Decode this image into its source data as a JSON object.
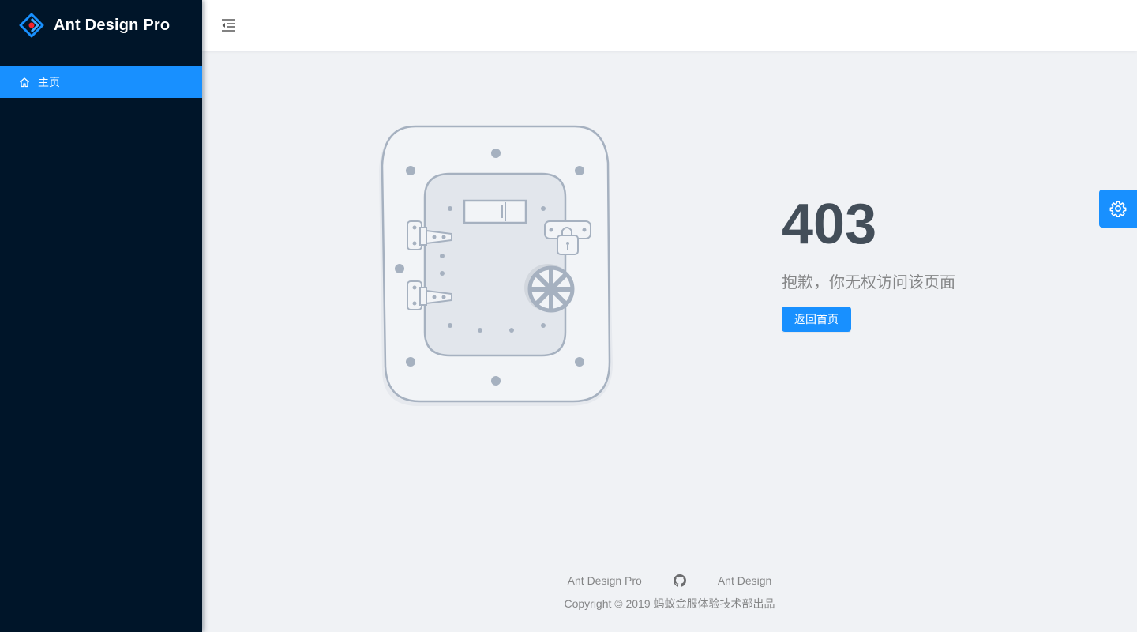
{
  "app": {
    "title": "Ant Design Pro"
  },
  "sidebar": {
    "items": [
      {
        "label": "主页",
        "icon": "home-icon",
        "active": true
      }
    ]
  },
  "header": {
    "trigger_icon": "menu-fold-icon"
  },
  "exception": {
    "code": "403",
    "description": "抱歉，你无权访问该页面",
    "button_label": "返回首页",
    "illustration": "locked-vault-door"
  },
  "footer": {
    "links": [
      {
        "label": "Ant Design Pro"
      },
      {
        "label": "",
        "icon": "github-icon"
      },
      {
        "label": "Ant Design"
      }
    ],
    "copyright": "Copyright © 2019 蚂蚁金服体验技术部出品"
  },
  "settings": {
    "icon": "gear-icon"
  },
  "colors": {
    "primary": "#1890ff",
    "sider": "#001529",
    "background": "#f0f2f5",
    "title": "#434e59"
  }
}
